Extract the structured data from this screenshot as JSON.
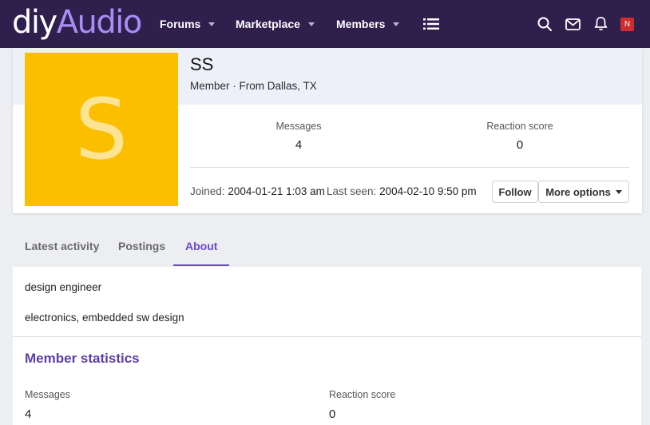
{
  "header": {
    "logo_part1": "diy",
    "logo_part2": "Audio",
    "nav": [
      {
        "label": "Forums"
      },
      {
        "label": "Marketplace"
      },
      {
        "label": "Members"
      }
    ],
    "icons": [
      "list-icon",
      "search-icon",
      "mail-icon",
      "bell-icon"
    ],
    "account_badge": "N",
    "brand_color": "#2e1f4d",
    "accent_color": "#a98ef5"
  },
  "profile": {
    "avatar_letter": "S",
    "avatar_color": "#fcbf00",
    "username": "SS",
    "title": "Member · From Dallas, TX",
    "stats": [
      {
        "label": "Messages",
        "value": "4"
      },
      {
        "label": "Reaction score",
        "value": "0"
      }
    ],
    "joined_label": "Joined:",
    "joined_value": "2004-01-21 1:03 am",
    "last_seen_label": "Last seen:",
    "last_seen_value": "2004-02-10 9:50 pm",
    "follow_label": "Follow",
    "more_options_label": "More options"
  },
  "tabs": [
    {
      "label": "Latest activity",
      "active": false
    },
    {
      "label": "Postings",
      "active": false
    },
    {
      "label": "About",
      "active": true
    }
  ],
  "about": {
    "lines": [
      "design engineer",
      "electronics, embedded sw design"
    ],
    "section_title": "Member statistics",
    "stats": [
      {
        "label": "Messages",
        "value": "4"
      },
      {
        "label": "Reaction score",
        "value": "0"
      }
    ]
  }
}
